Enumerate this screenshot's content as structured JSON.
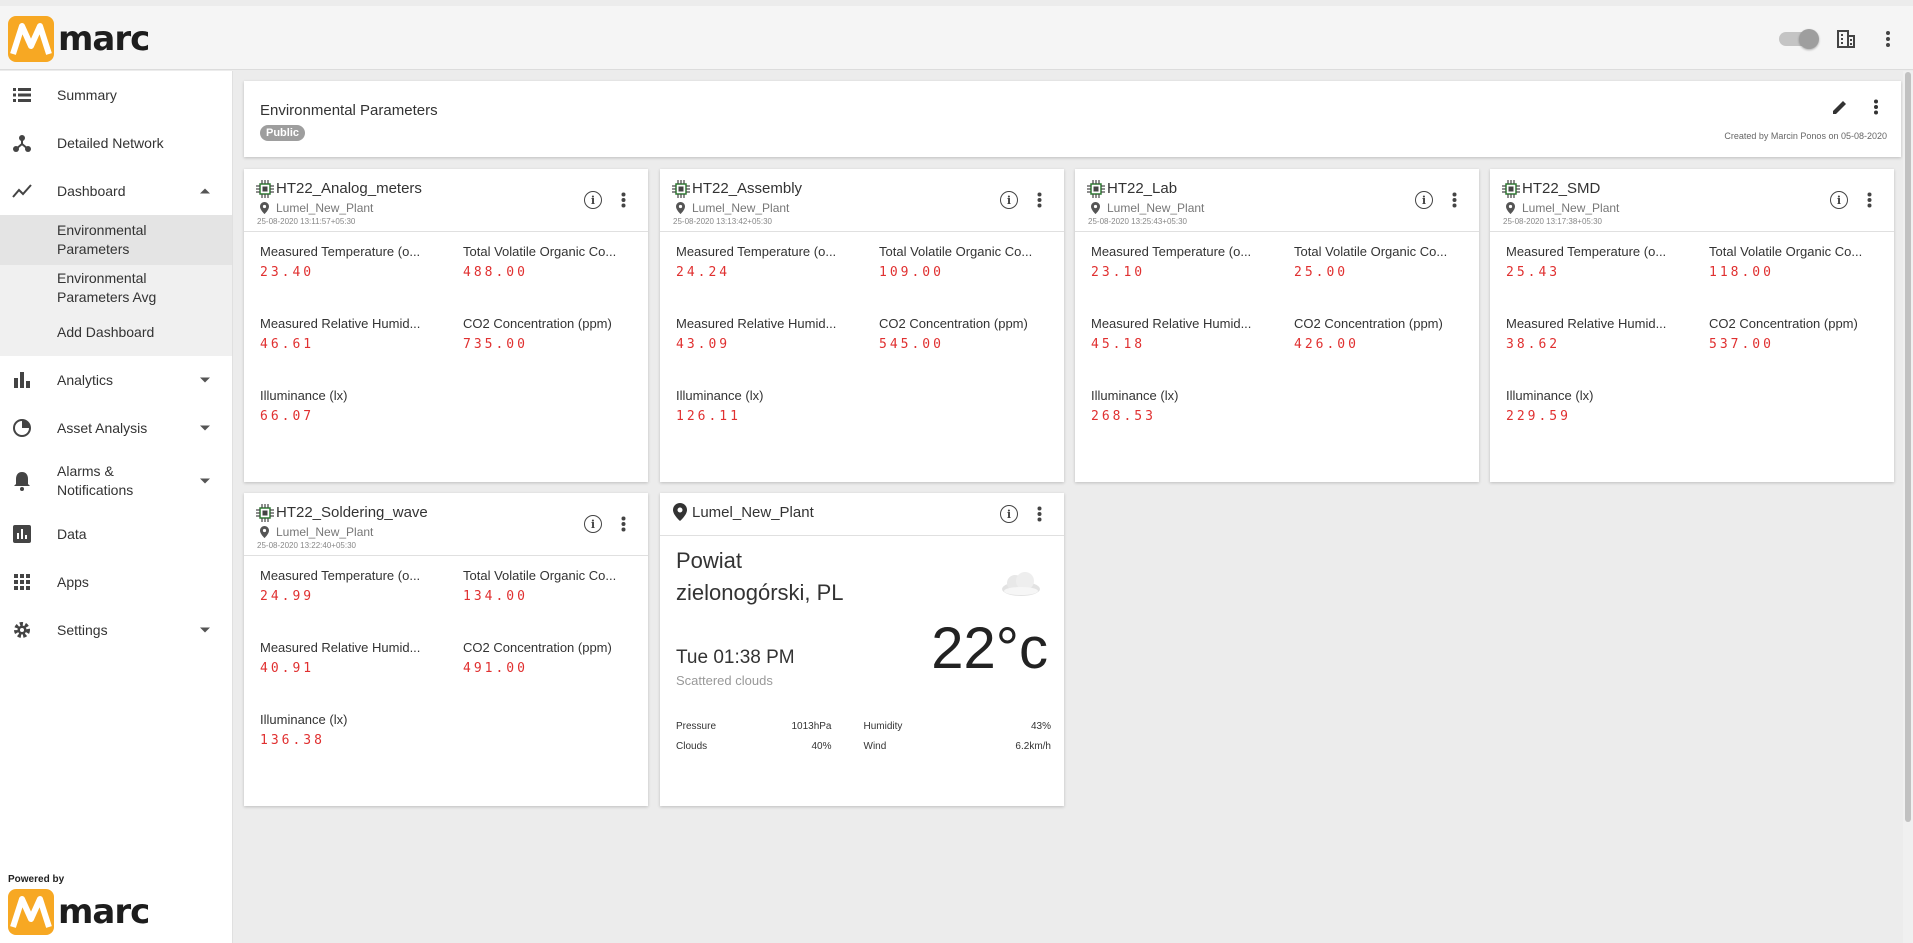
{
  "brand": {
    "name": "marc",
    "powered_by": "Powered by"
  },
  "sidebar": {
    "items": [
      {
        "label": "Summary"
      },
      {
        "label": "Detailed Network"
      },
      {
        "label": "Dashboard"
      },
      {
        "label": "Analytics"
      },
      {
        "label": "Asset Analysis"
      },
      {
        "label": "Alarms & Notifications"
      },
      {
        "label": "Data"
      },
      {
        "label": "Apps"
      },
      {
        "label": "Settings"
      }
    ],
    "dashboard_sub": [
      {
        "label": "Environmental Parameters"
      },
      {
        "label": "Environmental Parameters Avg"
      },
      {
        "label": "Add Dashboard"
      }
    ]
  },
  "dashboard": {
    "title": "Environmental Parameters",
    "badge": "Public",
    "created": "Created by Marcin Ponos on 05-08-2020"
  },
  "labels": {
    "temp": "Measured Temperature (o...",
    "tvoc": "Total Volatile Organic Co...",
    "rh": "Measured Relative Humid...",
    "co2": "CO2 Concentration (ppm)",
    "lux": "Illuminance (lx)"
  },
  "devices": [
    {
      "name": "HT22_Analog_meters",
      "location": "Lumel_New_Plant",
      "timestamp": "25-08-2020 13:11:57+05:30",
      "temp": "23.40",
      "tvoc": "488.00",
      "rh": "46.61",
      "co2": "735.00",
      "lux": "66.07"
    },
    {
      "name": "HT22_Assembly",
      "location": "Lumel_New_Plant",
      "timestamp": "25-08-2020 13:13:42+05:30",
      "temp": "24.24",
      "tvoc": "109.00",
      "rh": "43.09",
      "co2": "545.00",
      "lux": "126.11"
    },
    {
      "name": "HT22_Lab",
      "location": "Lumel_New_Plant",
      "timestamp": "25-08-2020 13:25:43+05:30",
      "temp": "23.10",
      "tvoc": "25.00",
      "rh": "45.18",
      "co2": "426.00",
      "lux": "268.53"
    },
    {
      "name": "HT22_SMD",
      "location": "Lumel_New_Plant",
      "timestamp": "25-08-2020 13:17:38+05:30",
      "temp": "25.43",
      "tvoc": "118.00",
      "rh": "38.62",
      "co2": "537.00",
      "lux": "229.59"
    },
    {
      "name": "HT22_Soldering_wave",
      "location": "Lumel_New_Plant",
      "timestamp": "25-08-2020 13:22:40+05:30",
      "temp": "24.99",
      "tvoc": "134.00",
      "rh": "40.91",
      "co2": "491.00",
      "lux": "136.38"
    }
  ],
  "weather": {
    "location": "Lumel_New_Plant",
    "city": "Powiat zielonogórski, PL",
    "time": "Tue 01:38 PM",
    "description": "Scattered clouds",
    "temperature": "22°c",
    "pressure_label": "Pressure",
    "pressure": "1013hPa",
    "humidity_label": "Humidity",
    "humidity": "43%",
    "clouds_label": "Clouds",
    "clouds": "40%",
    "wind_label": "Wind",
    "wind": "6.2km/h"
  },
  "colors": {
    "accent_red": "#e03030",
    "logo_orange": "#f7a823"
  }
}
